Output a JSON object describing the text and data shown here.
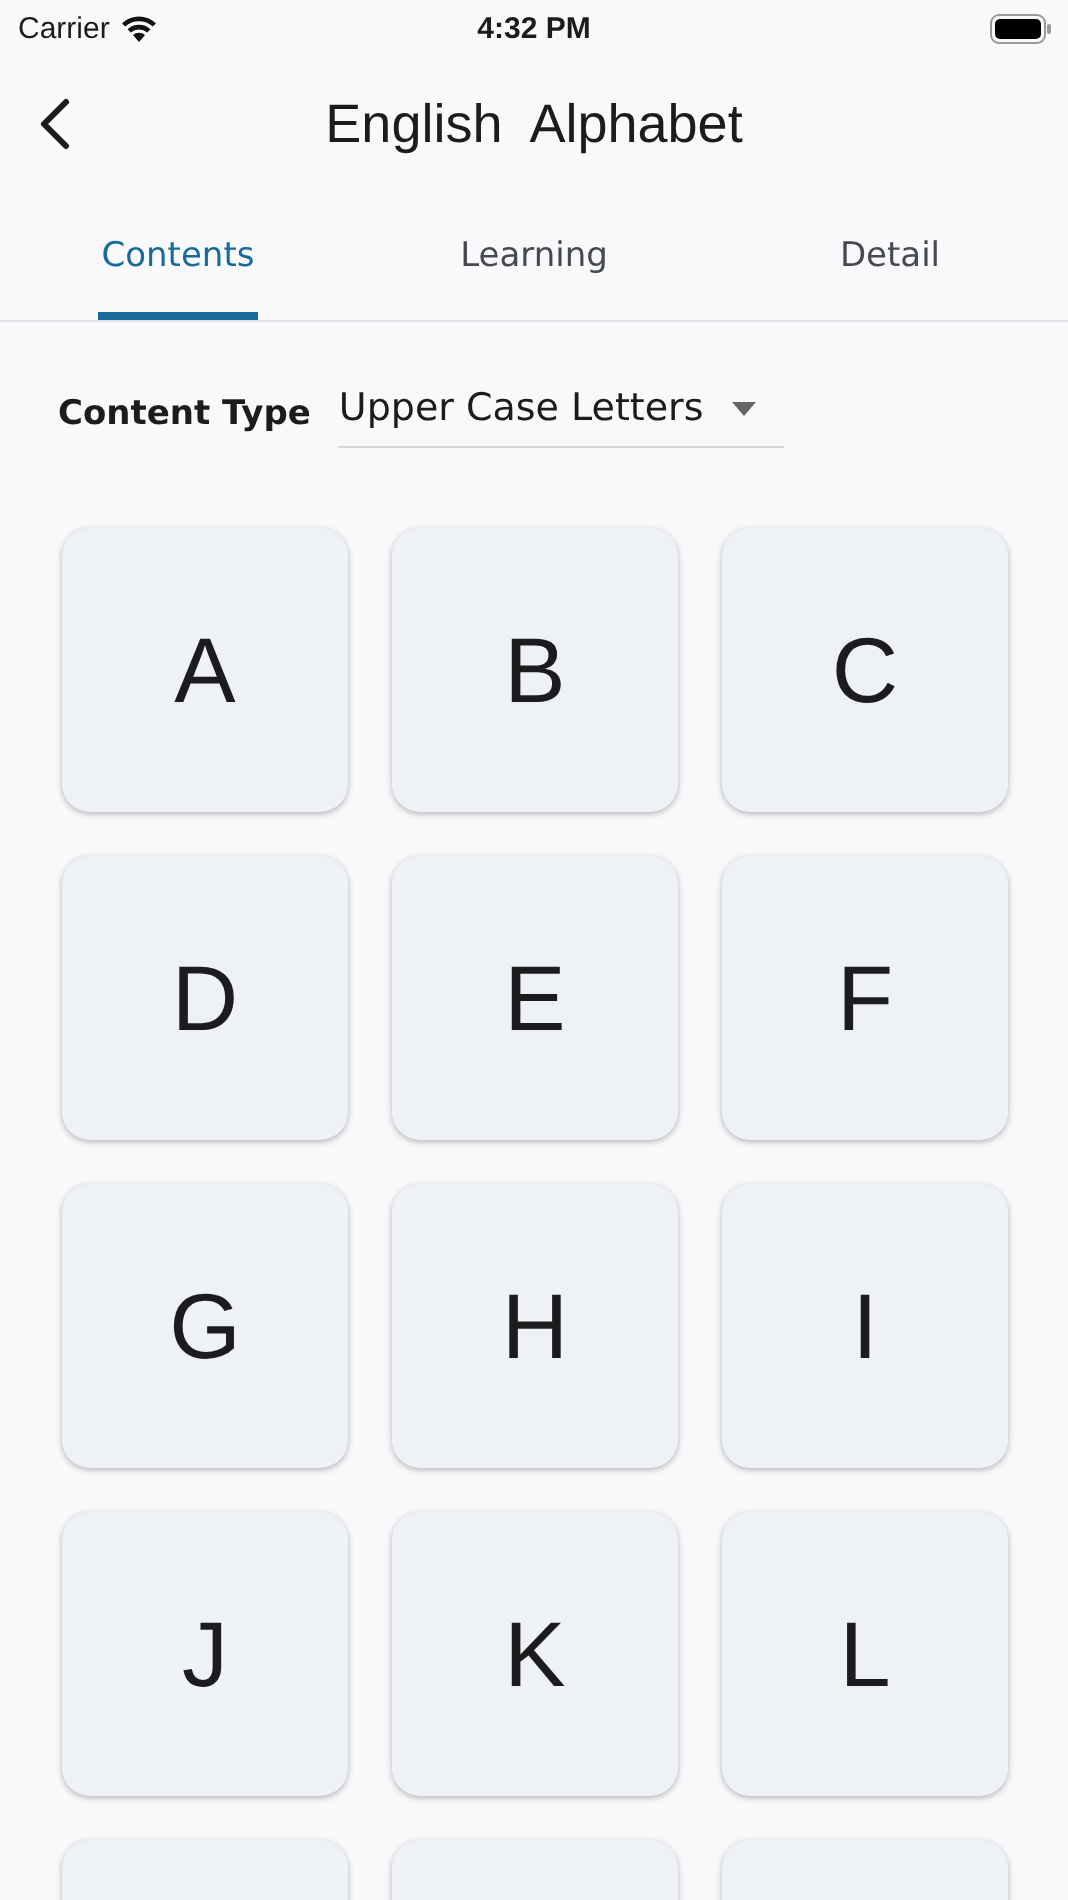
{
  "status_bar": {
    "carrier": "Carrier",
    "time": "4:32 PM"
  },
  "nav_bar": {
    "title": "English  Alphabet"
  },
  "tabs": [
    {
      "label": "Contents",
      "selected": true
    },
    {
      "label": "Learning",
      "selected": false
    },
    {
      "label": "Detail",
      "selected": false
    }
  ],
  "content_type": {
    "label": "Content Type",
    "value": "Upper Case Letters"
  },
  "cards": [
    {
      "kind": "letter",
      "letter": "A"
    },
    {
      "kind": "letter",
      "letter": "B"
    },
    {
      "kind": "letter",
      "letter": "C"
    },
    {
      "kind": "letter",
      "letter": "D"
    },
    {
      "kind": "letter",
      "letter": "E"
    },
    {
      "kind": "letter",
      "letter": "F"
    },
    {
      "kind": "letter",
      "letter": "G"
    },
    {
      "kind": "letter",
      "letter": "H"
    },
    {
      "kind": "letter",
      "letter": "I"
    },
    {
      "kind": "letter",
      "letter": "J"
    },
    {
      "kind": "letter",
      "letter": "K"
    },
    {
      "kind": "letter",
      "letter": "L"
    },
    {
      "kind": "partial"
    },
    {
      "kind": "partial"
    },
    {
      "kind": "partial"
    }
  ]
}
